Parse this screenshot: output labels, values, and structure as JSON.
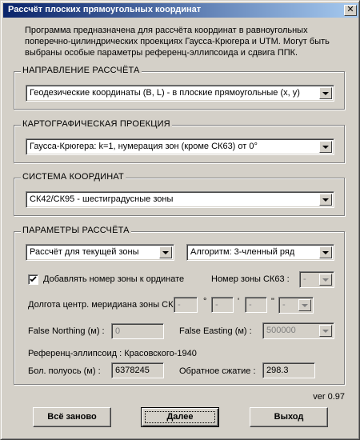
{
  "window": {
    "title": "Рассчёт плоских прямоугольных координат",
    "close_glyph": "✕"
  },
  "description": "Программа предназначена для рассчёта координат в равноугольных поперечно-цилиндрических проекциях Гаусса-Крюгера и UTM. Могут быть выбраны особые параметры референц-эллипсоида и сдвига ППК.",
  "direction": {
    "label": "НАПРАВЛЕНИЕ РАССЧЁТА",
    "selected": "Геодезические координаты (B, L) - в плоские прямоугольные (x, y)"
  },
  "projection": {
    "label": "КАРТОГРАФИЧЕСКАЯ ПРОЕКЦИЯ",
    "selected": "Гаусса-Крюгера:  k=1, нумерация зон (кроме СК63) от 0°"
  },
  "coord_system": {
    "label": "СИСТЕМА КООРДИНАТ",
    "selected": "СК42/СК95 - шестиградусные зоны"
  },
  "params": {
    "label": "ПАРАМЕТРЫ РАССЧЁТА",
    "zone_mode": "Рассчёт для текущей зоны",
    "algorithm": "Алгоритм: 3-членный ряд",
    "add_zone_label": "Добавлять номер зоны к ординате",
    "add_zone_checked": true,
    "zone_number_label": "Номер зоны СК63 :",
    "zone_number_value": "-",
    "meridian_label": "Долгота центр. меридиана зоны СК63 :",
    "meridian_deg": "-",
    "meridian_deg_unit": "°",
    "meridian_min": "-",
    "meridian_min_unit": "'",
    "meridian_sec": "-",
    "meridian_sec_unit": "\"",
    "meridian_sign": "-",
    "false_northing_label": "False Northing (м) :",
    "false_northing_value": "0",
    "false_easting_label": "False Easting (м) :",
    "false_easting_value": "500000",
    "ellipsoid_text": "Референц-эллипсоид : Красовского-1940",
    "semi_major_label": "Бол. полуось (м) :",
    "semi_major_value": "6378245",
    "inv_flattening_label": "Обратное сжатие :",
    "inv_flattening_value": "298.3"
  },
  "version": "ver 0.97",
  "buttons": {
    "reset": "Всё заново",
    "next": "Далее",
    "exit": "Выход"
  }
}
